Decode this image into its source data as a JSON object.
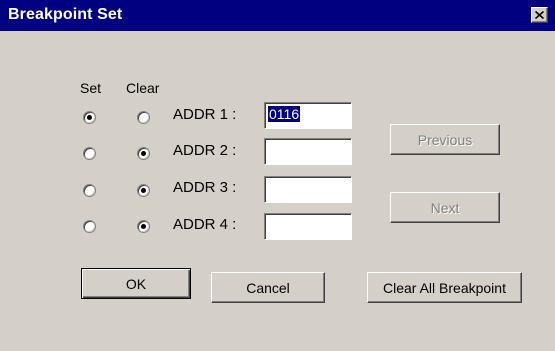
{
  "window": {
    "title": "Breakpoint Set",
    "close_icon": "close-icon"
  },
  "columns": {
    "set_label": "Set",
    "clear_label": "Clear"
  },
  "rows": [
    {
      "label": "ADDR 1 :",
      "value": "0116",
      "set_checked": true,
      "clear_checked": false,
      "value_selected": true
    },
    {
      "label": "ADDR 2 :",
      "value": "",
      "set_checked": false,
      "clear_checked": true,
      "value_selected": false
    },
    {
      "label": "ADDR 3 :",
      "value": "",
      "set_checked": false,
      "clear_checked": true,
      "value_selected": false
    },
    {
      "label": "ADDR 4 :",
      "value": "",
      "set_checked": false,
      "clear_checked": true,
      "value_selected": false
    }
  ],
  "buttons": {
    "previous": "Previous",
    "next": "Next",
    "ok": "OK",
    "cancel": "Cancel",
    "clear_all": "Clear All Breakpoint"
  },
  "colors": {
    "titlebar": "#000080",
    "face": "#d4d0c8",
    "selection": "#000080"
  }
}
